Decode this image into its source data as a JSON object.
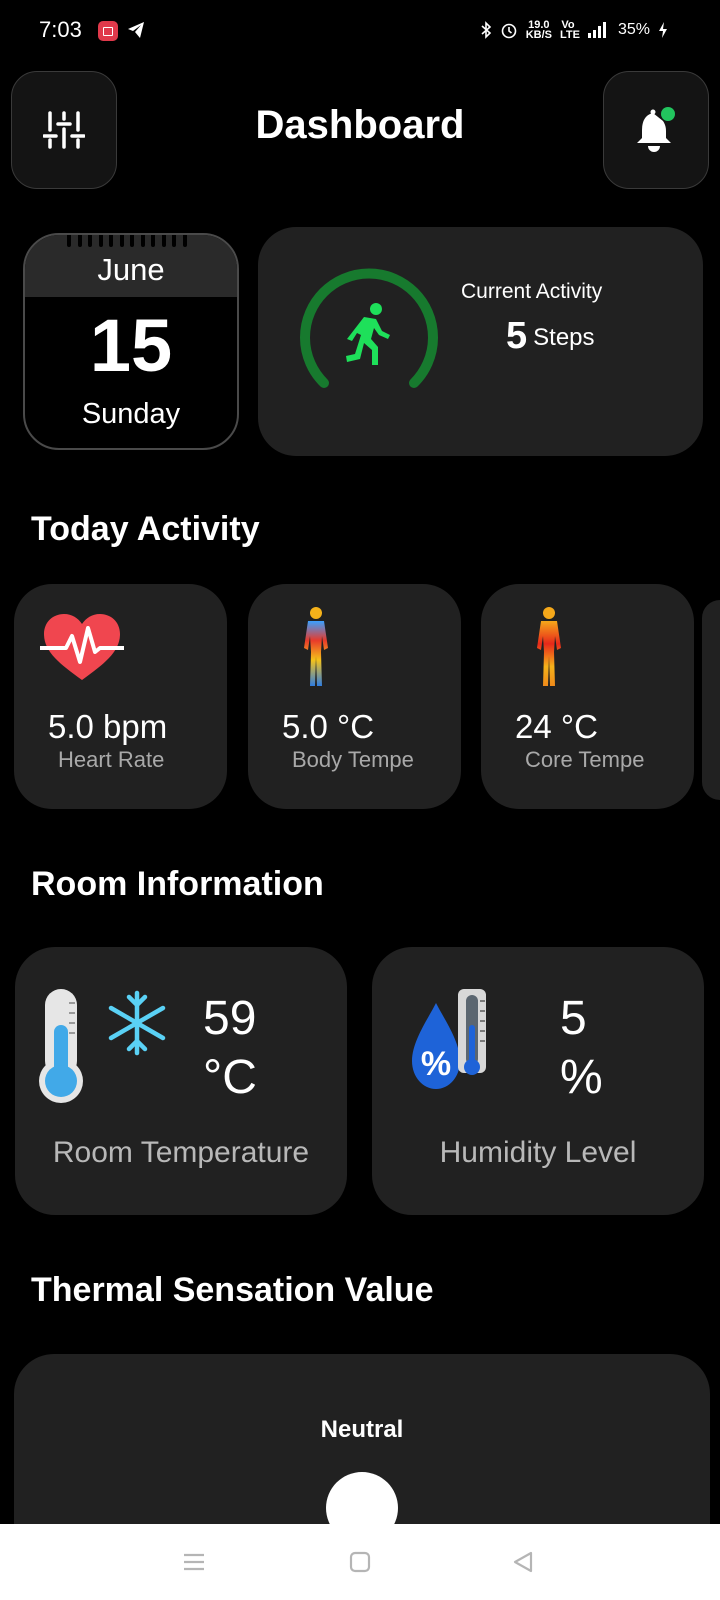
{
  "status_bar": {
    "time": "7:03",
    "speed_top": "19.0",
    "speed_unit": "KB/S",
    "network": "Vo LTE",
    "battery": "35%",
    "icons": [
      "screen-record-icon",
      "telegram-icon",
      "bluetooth-icon",
      "alarm-icon",
      "signal-icon",
      "charging-icon"
    ]
  },
  "header": {
    "title": "Dashboard",
    "left_icon": "sliders-icon",
    "right_icon": "bell-icon",
    "notification_dot_color": "#22c55e"
  },
  "date_card": {
    "month": "June",
    "day": "15",
    "weekday": "Sunday"
  },
  "activity": {
    "label": "Current Activity",
    "steps": "5",
    "steps_unit": "Steps",
    "accent_color": "#1ee05a",
    "ring_color": "#177a2e"
  },
  "today_activity": {
    "title": "Today Activity",
    "cards": [
      {
        "icon": "heartbeat-icon",
        "value": "5.0 bpm",
        "label": "Heart Rate"
      },
      {
        "icon": "body-thermal-icon",
        "value": "5.0 °C",
        "label": "Body Tempe"
      },
      {
        "icon": "body-core-icon",
        "value": "24 °C",
        "label": "Core Tempe"
      }
    ]
  },
  "room_info": {
    "title": "Room Information",
    "cards": [
      {
        "icon": "thermometer-snowflake-icon",
        "value_line1": "59",
        "value_line2": "°C",
        "label": "Room Temperature"
      },
      {
        "icon": "humidity-drop-icon",
        "value_line1": "5",
        "value_line2": "%",
        "label": "Humidity Level"
      }
    ]
  },
  "thermal": {
    "title": "Thermal Sensation Value",
    "label": "Neutral"
  },
  "nav_bar": {
    "icons": [
      "menu-icon",
      "home-icon",
      "back-icon"
    ]
  }
}
